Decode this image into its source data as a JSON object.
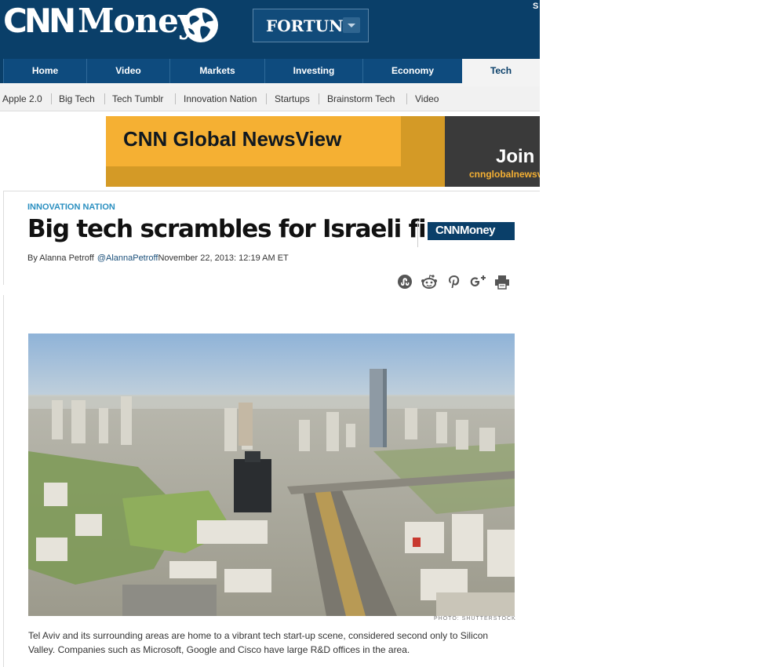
{
  "header": {
    "logo_cnn": "CNN",
    "logo_money": "Money",
    "fortune_label": "FORTUNE",
    "right_text": "S"
  },
  "nav": {
    "items": [
      {
        "label": "Home"
      },
      {
        "label": "Video"
      },
      {
        "label": "Markets"
      },
      {
        "label": "Investing"
      },
      {
        "label": "Economy"
      },
      {
        "label": "Tech"
      }
    ],
    "active_index": 5
  },
  "subnav": {
    "items": [
      {
        "label": "Apple 2.0"
      },
      {
        "label": "Big Tech"
      },
      {
        "label": "Tech Tumblr"
      },
      {
        "label": "Innovation Nation"
      },
      {
        "label": "Startups"
      },
      {
        "label": "Brainstorm Tech"
      },
      {
        "label": "Video"
      }
    ]
  },
  "ad": {
    "title": "CNN Global NewsView",
    "cta": "Join",
    "url": "cnnglobalnewsv"
  },
  "article": {
    "kicker": "INNOVATION NATION",
    "headline": "Big tech scrambles for Israeli firms",
    "badge": "CNNMoney",
    "byline": {
      "by": "By Alanna Petroff",
      "handle": "@AlannaPetroff",
      "date": "November 22, 2013: 12:19 AM ET"
    },
    "share_icons": [
      "stumbleupon-icon",
      "reddit-icon",
      "pinterest-icon",
      "google-plus-icon",
      "print-icon"
    ],
    "photo_credit": "PHOTO: SHUTTERSTOCK",
    "caption": "Tel Aviv and its surrounding areas are home to a vibrant tech start-up scene, considered second only to Silicon Valley. Companies such as Microsoft, Google and Cisco have large R&D offices in the area."
  },
  "colors": {
    "header_bg": "#0a3f69",
    "nav_bg": "#0e4b7e",
    "kicker": "#2a8fc0",
    "ad_yellow": "#f5b033"
  }
}
